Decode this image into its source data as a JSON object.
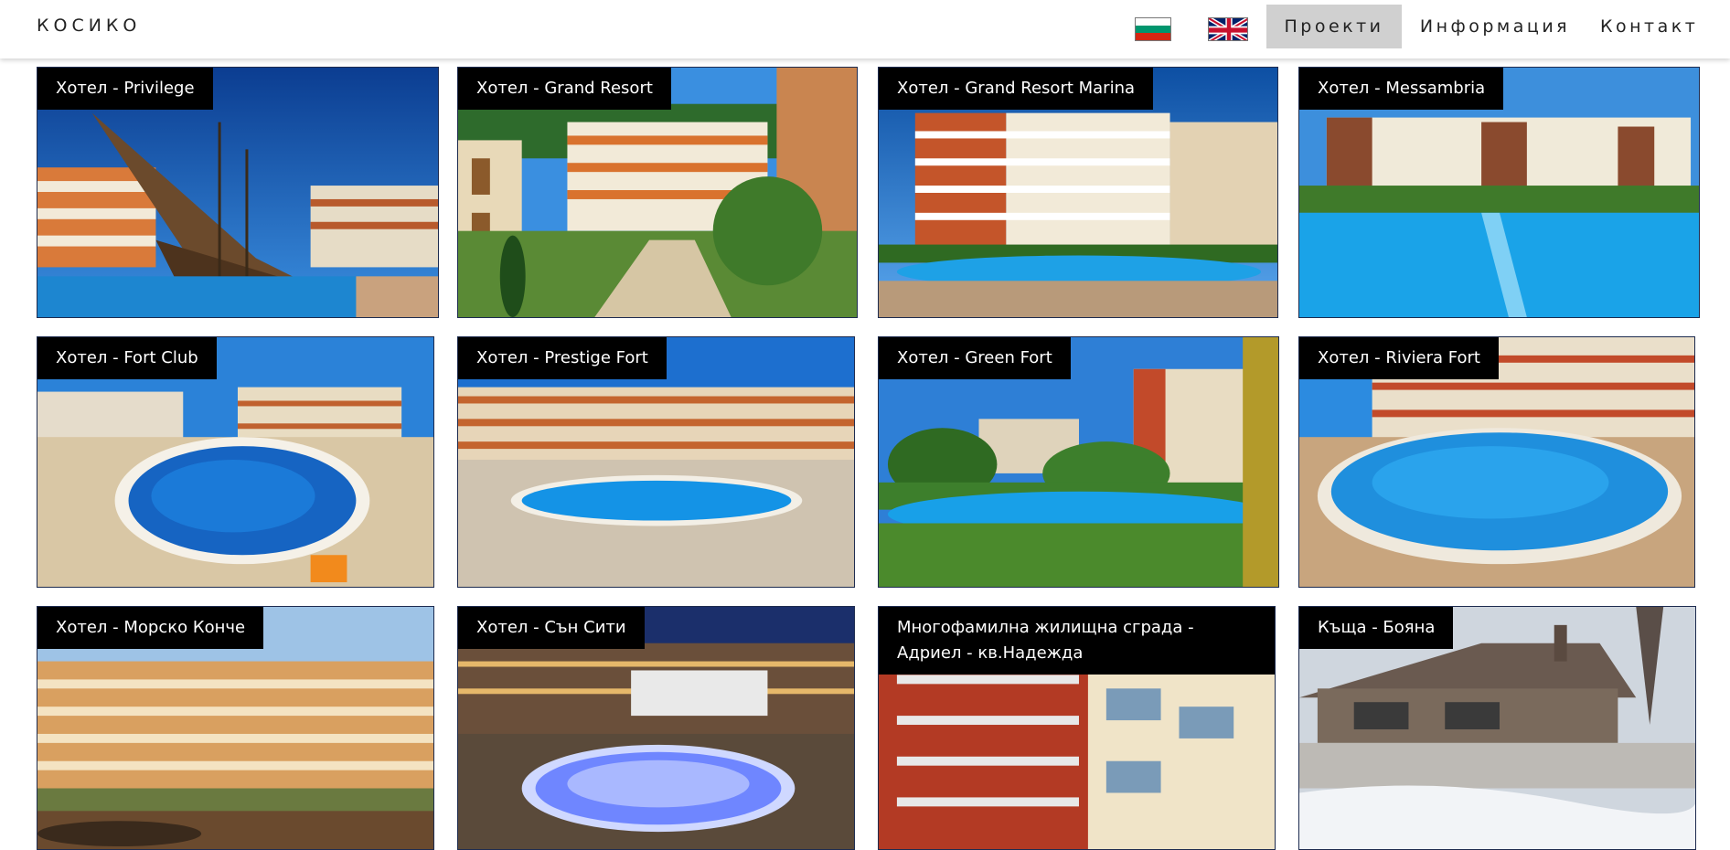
{
  "header": {
    "logo": "КОСИКО",
    "nav": {
      "projects": "Проекти",
      "info": "Информация",
      "contact": "Контакт"
    },
    "languages": {
      "bulgarian_flag": "bulgarian-flag-icon",
      "english_flag": "uk-flag-icon"
    }
  },
  "colors": {
    "active_nav_bg": "#d0d0d0",
    "caption_bg": "#000000",
    "sky": "#1f7ad6",
    "pool": "#1a8fd8"
  },
  "projects": [
    {
      "title": "Хотел - Privilege"
    },
    {
      "title": "Хотел - Grand Resort"
    },
    {
      "title": "Хотел - Grand Resort Marina"
    },
    {
      "title": "Хотел - Messambria"
    },
    {
      "title": "Хотел - Fort Club"
    },
    {
      "title": "Хотел - Prestige Fort"
    },
    {
      "title": "Хотел - Green Fort"
    },
    {
      "title": "Хотел - Riviera Fort"
    },
    {
      "title": "Хотел - Морско Конче"
    },
    {
      "title": "Хотел - Сън Сити"
    },
    {
      "title": "Многофамилна жилищна сграда - Адриел - кв.Надежда"
    },
    {
      "title": "Къща - Бояна"
    }
  ]
}
